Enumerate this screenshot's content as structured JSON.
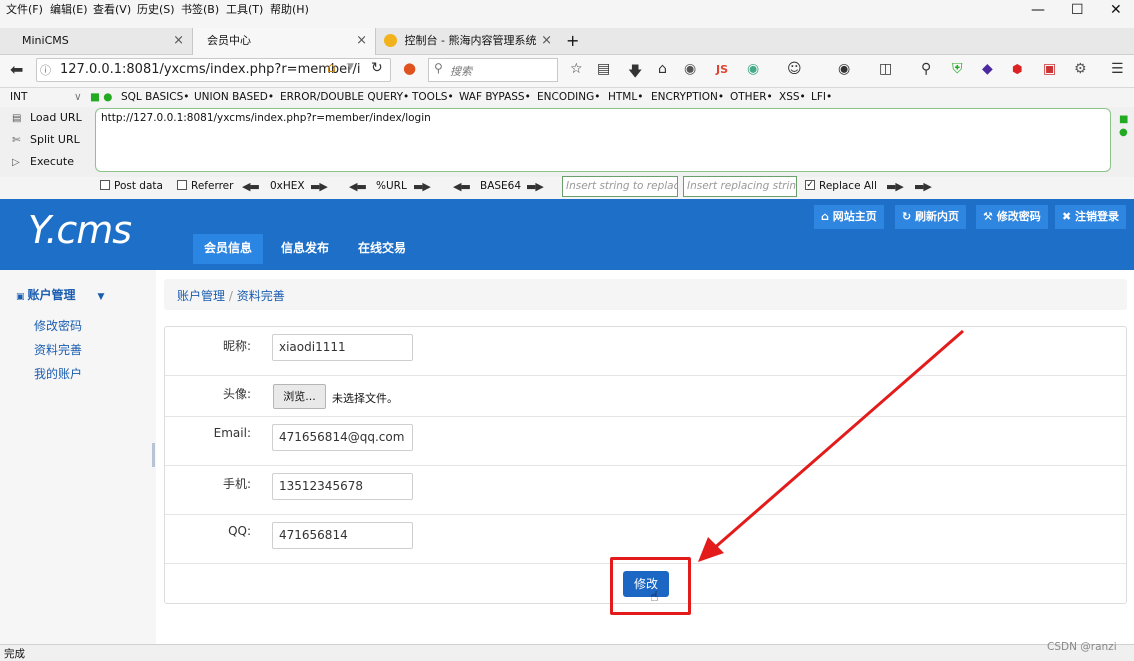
{
  "menubar": {
    "items": [
      "文件(F)",
      "编辑(E)",
      "查看(V)",
      "历史(S)",
      "书签(B)",
      "工具(T)",
      "帮助(H)"
    ]
  },
  "tabs": [
    {
      "title": "MiniCMS",
      "close": "×"
    },
    {
      "title": "会员中心",
      "close": "×"
    },
    {
      "title": "控制台 - 熊海内容管理系统",
      "close": "×"
    },
    {
      "title": "+"
    }
  ],
  "navbar": {
    "url": "127.0.0.1:8081/yxcms/index.php?r=member/i",
    "search_placeholder": "搜索"
  },
  "hackbar": {
    "menu": [
      "INT",
      "SQL BASICS•",
      "UNION BASED•",
      "ERROR/DOUBLE QUERY•",
      "TOOLS•",
      "WAF BYPASS•",
      "ENCODING•",
      "HTML•",
      "ENCRYPTION•",
      "OTHER•",
      "XSS•",
      "LFI•"
    ],
    "side": [
      "Load URL",
      "Split URL",
      "Execute"
    ],
    "url": "http://127.0.0.1:8081/yxcms/index.php?r=member/index/login",
    "options": {
      "post_data": "Post data",
      "referrer": "Referrer",
      "hex": "0xHEX",
      "url": "%URL",
      "base64": "BASE64",
      "insert_placeholder": "Insert string to replace",
      "replacing_placeholder": "Insert replacing string",
      "replace_all": "Replace All"
    }
  },
  "site": {
    "logo": "Y.cms",
    "nav": [
      "会员信息",
      "信息发布",
      "在线交易"
    ],
    "header_buttons": [
      "网站主页",
      "刷新内页",
      "修改密码",
      "注销登录"
    ]
  },
  "sidebar": {
    "title": "账户管理",
    "links": [
      "修改密码",
      "资料完善",
      "我的账户"
    ]
  },
  "breadcrumb": {
    "parent": "账户管理",
    "sep": "/",
    "current": "资料完善"
  },
  "form": {
    "nickname_label": "昵称:",
    "nickname_value": "xiaodi1111",
    "avatar_label": "头像:",
    "browse_button": "浏览...",
    "no_file": "未选择文件。",
    "email_label": "Email:",
    "email_value": "471656814@qq.com",
    "phone_label": "手机:",
    "phone_value": "13512345678",
    "qq_label": "QQ:",
    "qq_value": "471656814",
    "submit": "修改"
  },
  "status": {
    "text": "完成",
    "watermark": "CSDN @ranzi"
  },
  "colors": {
    "brand_blue": "#1e6fc7",
    "annotation_red": "#e31b1b"
  }
}
